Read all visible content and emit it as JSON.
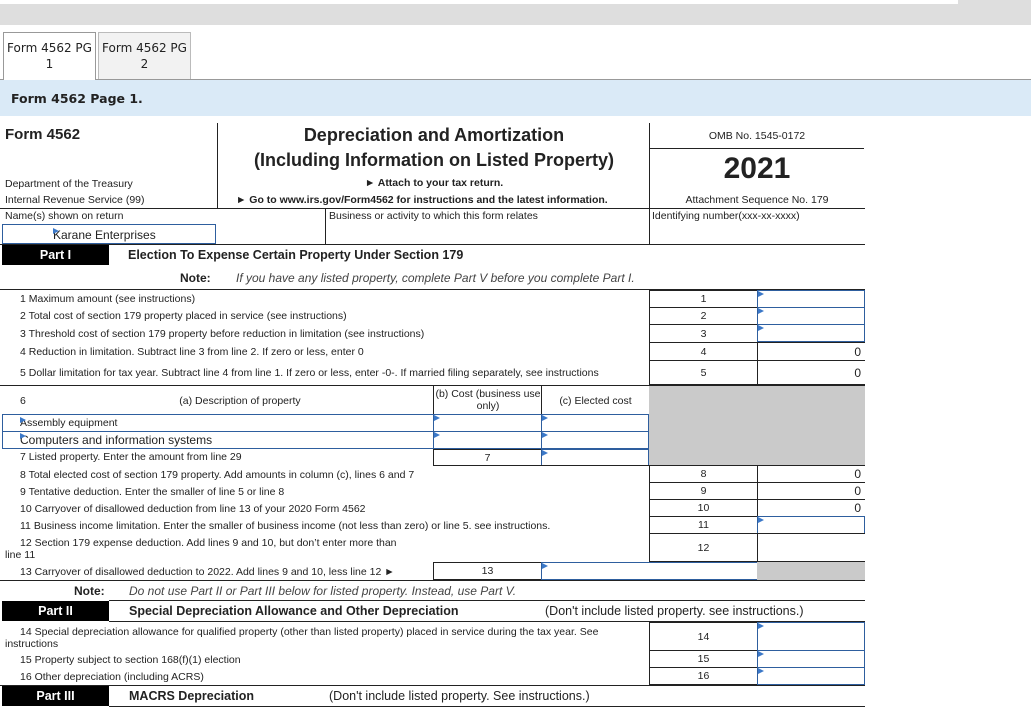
{
  "tabs": [
    {
      "label": "Form 4562 PG 1",
      "active": true
    },
    {
      "label": "Form 4562 PG 2",
      "active": false
    }
  ],
  "page_heading": "Form 4562 Page 1.",
  "header": {
    "form_number": "Form 4562",
    "title_line1": "Depreciation and Amortization",
    "title_line2": "(Including Information on Listed Property)",
    "attach": "► Attach to your tax return.",
    "goto": "► Go to www.irs.gov/Form4562 for instructions and the latest information.",
    "dept": "Department of the Treasury",
    "irs": "Internal Revenue Service (99)",
    "omb": "OMB No. 1545-0172",
    "year": "2021",
    "attachment_seq": "Attachment Sequence No. 179",
    "name_label": "Name(s) shown on return",
    "name_value": "Karane Enterprises",
    "business_label": "Business or activity to which this form relates",
    "id_label": "Identifying number(xxx-xx-xxxx)"
  },
  "part1": {
    "label": "Part I",
    "title": "Election To Expense Certain Property Under Section 179",
    "note_label": "Note:",
    "note_text": "If you have any listed property, complete Part V before you complete Part I.",
    "lines": [
      {
        "num": "1",
        "text": "1  Maximum amount (see instructions)",
        "value": "",
        "editable": true
      },
      {
        "num": "2",
        "text": "2  Total cost of section 179 property placed in service (see instructions)",
        "value": "",
        "editable": true
      },
      {
        "num": "3",
        "text": "3  Threshold cost of section 179 property before reduction in limitation (see instructions)",
        "value": "",
        "editable": true
      },
      {
        "num": "4",
        "text": "4  Reduction in limitation.  Subtract line 3 from line 2.  If zero or less, enter 0",
        "value": "0",
        "editable": false
      },
      {
        "num": "5",
        "text": "5  Dollar limitation for tax year.  Subtract line 4 from line 1.  If zero or less, enter -0-.  If married filing separately, see instructions",
        "value": "0",
        "editable": false
      }
    ],
    "line6": {
      "num": "6",
      "col_a": "(a) Description of property",
      "col_b": "(b) Cost (business use only)",
      "col_c": "(c) Elected cost",
      "rows": [
        {
          "description": "Assembly equipment",
          "cost": "",
          "elected": ""
        },
        {
          "description": "Computers and information systems",
          "cost": "",
          "elected": ""
        }
      ]
    },
    "line7": {
      "text": "7  Listed property.  Enter the amount from line 29",
      "num": "7",
      "value": ""
    },
    "lines_8_12": [
      {
        "num": "8",
        "text": "8  Total elected cost of section 179 property.  Add amounts in column (c), lines 6 and 7",
        "value": "0",
        "editable": false
      },
      {
        "num": "9",
        "text": "9  Tentative deduction.  Enter the smaller of line 5 or line 8",
        "value": "0",
        "editable": false
      },
      {
        "num": "10",
        "text": "10 Carryover of disallowed deduction from line 13 of your 2020 Form 4562",
        "value": "0",
        "editable": false
      },
      {
        "num": "11",
        "text": "11 Business income limitation.  Enter the smaller of business income (not less than zero) or line 5. see instructions.",
        "value": "",
        "editable": true
      },
      {
        "num": "12",
        "text_l1": "12 Section 179 expense deduction. Add lines 9 and 10, but don’t enter more than",
        "text_l2": "line 11",
        "value": "",
        "editable": false
      }
    ],
    "line13": {
      "text": "13 Carryover of disallowed deduction to 2022. Add lines 9 and 10, less line 12 ►",
      "num": "13",
      "value": ""
    },
    "note2_label": "Note:",
    "note2_text": "Do not use Part II or Part III below for listed property. Instead, use Part V."
  },
  "part2": {
    "label": "Part II",
    "title": "Special Depreciation Allowance and Other Depreciation",
    "subtitle": "(Don't include listed property. see instructions.)",
    "lines": [
      {
        "num": "14",
        "text_l1": "14 Special depreciation allowance for qualified property (other than listed property) placed in service during the tax year. See",
        "text_l2": "instructions",
        "value": ""
      },
      {
        "num": "15",
        "text": "15 Property subject to section 168(f)(1) election",
        "value": ""
      },
      {
        "num": "16",
        "text": "16 Other depreciation (including ACRS)",
        "value": ""
      }
    ]
  },
  "part3": {
    "label": "Part III",
    "title": "MACRS Depreciation",
    "subtitle": "(Don't include listed property. See instructions.)"
  }
}
